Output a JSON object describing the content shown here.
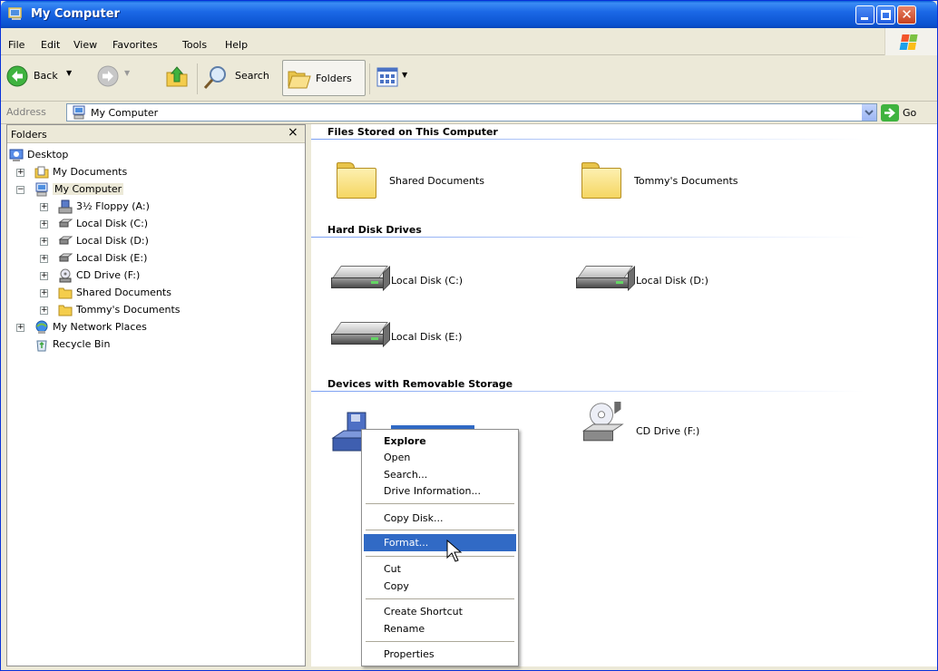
{
  "window": {
    "title": "My Computer",
    "colors": {
      "titlebar": "#0b53d0",
      "selection": "#316ac5",
      "chrome": "#ece9d8"
    }
  },
  "menu": [
    "File",
    "Edit",
    "View",
    "Favorites",
    "Tools",
    "Help"
  ],
  "toolbar": {
    "back_label": "Back",
    "search_label": "Search",
    "folders_label": "Folders",
    "icons": [
      "back-arrow-icon",
      "forward-arrow-icon",
      "up-folder-icon",
      "search-icon",
      "folders-icon",
      "views-icon"
    ]
  },
  "address": {
    "label": "Address",
    "value": "My Computer",
    "go_label": "Go"
  },
  "folders_pane": {
    "title": "Folders",
    "close_glyph": "×",
    "tree": [
      {
        "label": "Desktop"
      },
      {
        "label": "My Documents"
      },
      {
        "label": "My Computer"
      },
      {
        "label": "3½ Floppy (A:)"
      },
      {
        "label": "Local Disk (C:)"
      },
      {
        "label": "Local Disk (D:)"
      },
      {
        "label": "Local Disk (E:)"
      },
      {
        "label": "CD Drive (F:)"
      },
      {
        "label": "Shared Documents"
      },
      {
        "label": "Tommy's Documents"
      },
      {
        "label": "My Network Places"
      },
      {
        "label": "Recycle Bin"
      }
    ]
  },
  "content": {
    "groups": [
      {
        "title": "Files Stored on This Computer",
        "items": [
          "Shared Documents",
          "Tommy's Documents"
        ]
      },
      {
        "title": "Hard Disk Drives",
        "items": [
          "Local Disk (C:)",
          "Local Disk (D:)",
          "Local Disk (E:)"
        ]
      },
      {
        "title": "Devices with Removable Storage",
        "items": [
          "",
          "CD Drive (F:)"
        ]
      }
    ]
  },
  "context_menu": {
    "items": [
      "Explore",
      "Open",
      "Search...",
      "Drive Information...",
      "Copy Disk...",
      "Format...",
      "Cut",
      "Copy",
      "Create Shortcut",
      "Rename",
      "Properties"
    ],
    "highlighted": "Format..."
  }
}
